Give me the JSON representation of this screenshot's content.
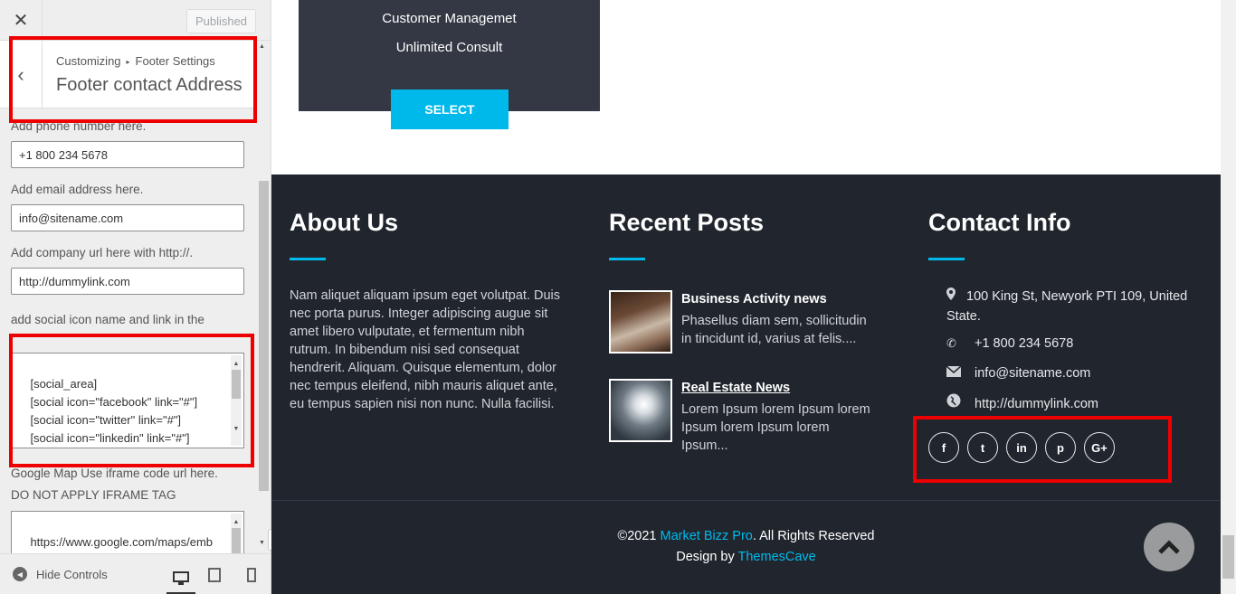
{
  "sidebar": {
    "close_glyph": "✕",
    "published_label": "Published",
    "back_glyph": "‹",
    "breadcrumb": {
      "parent": "Customizing",
      "sep": "▸",
      "current": "Footer Settings"
    },
    "section_title": "Footer contact Address",
    "fields": [
      {
        "label": "Add phone number here.",
        "value": "+1 800 234 5678"
      },
      {
        "label": "Add email address here.",
        "value": "info@sitename.com"
      },
      {
        "label": "Add company url here with http://.",
        "value": "http://dummylink.com"
      }
    ],
    "social_label": "add social icon name and link in the shortcodes",
    "social_value": "[social_area]\n    [social icon=\"facebook\" link=\"#\"]\n    [social icon=\"twitter\" link=\"#\"]\n    [social icon=\"linkedin\" link=\"#\"]\n    [social icon=\"pinterest\" link=\"#\"]",
    "map_label_1": "Google Map Use iframe code url here.",
    "map_label_2": "DO NOT APPLY IFRAME TAG",
    "map_value": "https://www.google.com/maps/emb\ned?",
    "hide_controls_label": "Hide Controls"
  },
  "preview": {
    "pricing": {
      "features": [
        "Customer Managemet",
        "Unlimited Consult"
      ],
      "select_label": "SELECT"
    },
    "footer": {
      "about": {
        "title": "About Us",
        "text": "Nam aliquet aliquam ipsum eget volutpat. Duis nec porta purus. Integer adipiscing augue sit amet libero vulputate, et fermentum nibh rutrum. In bibendum nisi sed consequat hendrerit. Aliquam. Quisque elementum, dolor nec tempus eleifend, nibh mauris aliquet ante, eu tempus sapien nisi non nunc. Nulla facilisi."
      },
      "recent": {
        "title": "Recent Posts",
        "posts": [
          {
            "title": "Business Activity news",
            "excerpt": "Phasellus diam sem, sollicitudin in tincidunt id, varius at felis...."
          },
          {
            "title": "Real Estate News",
            "excerpt": "Lorem Ipsum lorem Ipsum lorem Ipsum lorem Ipsum lorem Ipsum..."
          }
        ]
      },
      "contact": {
        "title": "Contact Info",
        "address": "100 King St, Newyork PTI 109, United State.",
        "phone": "+1 800 234 5678",
        "email": "info@sitename.com",
        "url": "http://dummylink.com",
        "social": [
          {
            "name": "facebook",
            "glyph": "f"
          },
          {
            "name": "twitter",
            "glyph": "t"
          },
          {
            "name": "linkedin",
            "glyph": "in"
          },
          {
            "name": "pinterest",
            "glyph": "p"
          },
          {
            "name": "google-plus",
            "glyph": "G+"
          }
        ]
      },
      "copyright_prefix": "©2021 ",
      "copyright_brand": "Market Bizz Pro",
      "copyright_suffix": ". All Rights Reserved",
      "design_prefix": "Design by ",
      "design_brand": "ThemesCave"
    }
  },
  "colors": {
    "accent": "#00b9eb",
    "footer_bg": "#21262e",
    "card_bg": "#343844",
    "highlight": "#e00000"
  }
}
